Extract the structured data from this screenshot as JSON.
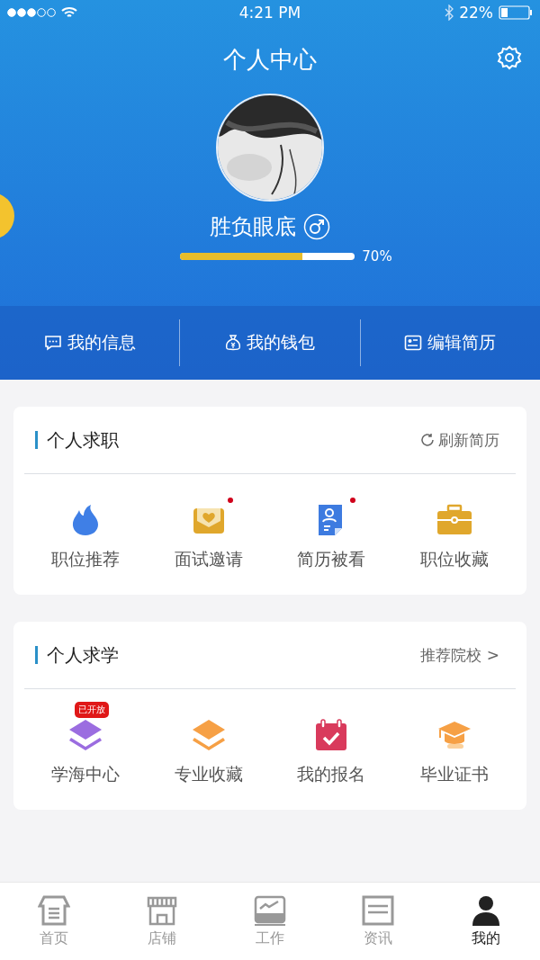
{
  "status_bar": {
    "time": "4:21 PM",
    "battery": "22%"
  },
  "header": {
    "title": "个人中心"
  },
  "profile": {
    "name": "胜负眼底",
    "completion": {
      "level": 0.7,
      "reading": "70%"
    }
  },
  "quick_links": [
    {
      "label": "我的信息",
      "kind": "chat"
    },
    {
      "label": "我的钱包",
      "kind": "wallet"
    },
    {
      "label": "编辑简历",
      "kind": "resume"
    }
  ],
  "sections": [
    {
      "title": "个人求职",
      "action": {
        "label": "刷新简历",
        "kind": "refresh"
      },
      "items": [
        {
          "label": "职位推荐",
          "kind": "flame",
          "dot": false
        },
        {
          "label": "面试邀请",
          "kind": "envelope",
          "dot": true
        },
        {
          "label": "简历被看",
          "kind": "document",
          "dot": true
        },
        {
          "label": "职位收藏",
          "kind": "briefcase",
          "dot": false
        }
      ]
    },
    {
      "title": "个人求学",
      "action": {
        "label": "推荐院校 >",
        "kind": "link"
      },
      "items": [
        {
          "label": "学海中心",
          "kind": "layers-purple",
          "dot": false,
          "badge": "已开放"
        },
        {
          "label": "专业收藏",
          "kind": "layers-orange",
          "dot": false
        },
        {
          "label": "我的报名",
          "kind": "calendar",
          "dot": false
        },
        {
          "label": "毕业证书",
          "kind": "cap",
          "dot": false
        }
      ]
    }
  ],
  "tab_bar": [
    {
      "label": "首页",
      "kind": "home",
      "selected": false
    },
    {
      "label": "店铺",
      "kind": "store",
      "selected": false
    },
    {
      "label": "工作",
      "kind": "chart",
      "selected": false
    },
    {
      "label": "资讯",
      "kind": "news",
      "selected": false
    },
    {
      "label": "我的",
      "kind": "person",
      "selected": true
    }
  ]
}
